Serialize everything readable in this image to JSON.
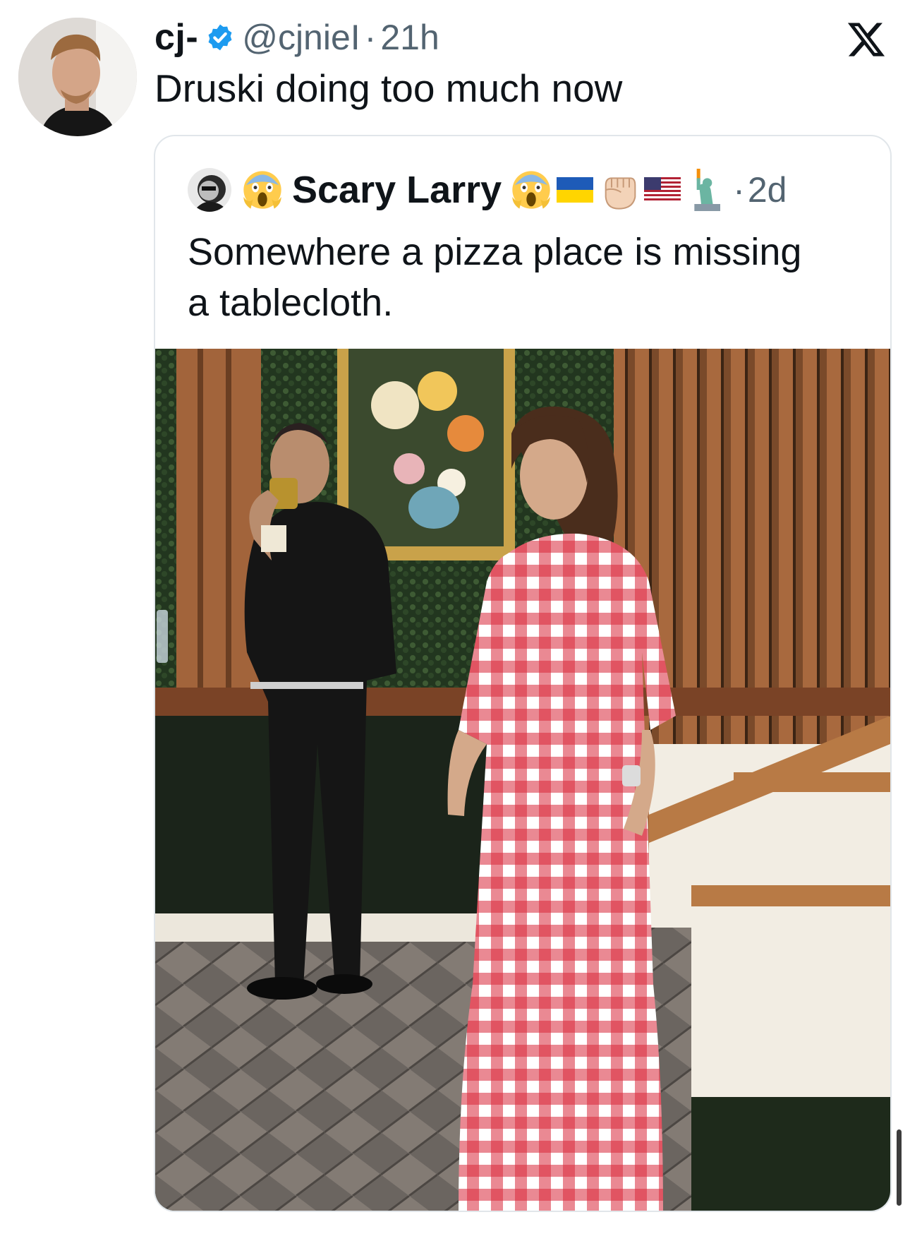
{
  "tweet": {
    "display_name": "cj-",
    "handle": "@cjnieI",
    "separator": "·",
    "time": "21h",
    "text": "Druski doing too much now",
    "verified": true
  },
  "quote": {
    "display_name": "Scary Larry",
    "separator": "·",
    "time": "2d",
    "text": "Somewhere a pizza place is missing\na tablecloth.",
    "name_emojis": [
      "screaming-face-emoji",
      "screaming-face-emoji",
      "ukraine-flag",
      "raised-fist-emoji",
      "us-flag",
      "statue-of-liberty-emoji"
    ]
  },
  "icons": {
    "x_logo": "x-logo-icon",
    "verified": "verified-badge-icon"
  },
  "colors": {
    "verified_blue": "#1d9bf0",
    "secondary_text": "#536471",
    "border": "#e1e6ea",
    "gingham_red": "#d8283a"
  }
}
